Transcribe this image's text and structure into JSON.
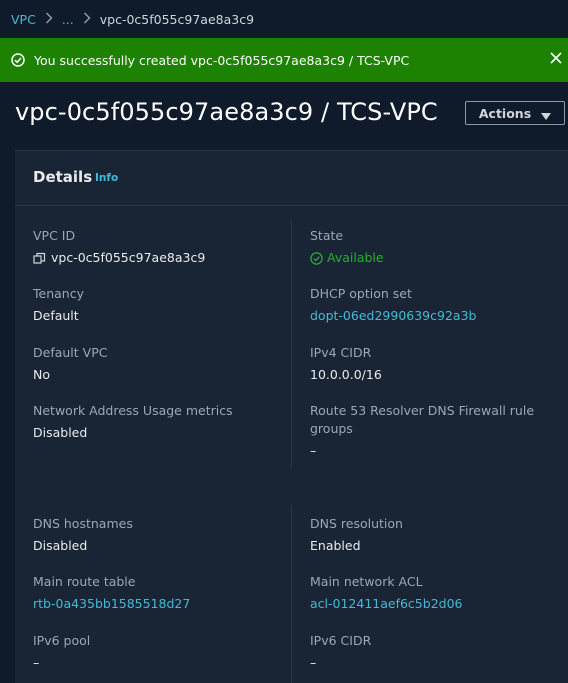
{
  "breadcrumb": {
    "root": "VPC",
    "ellipsis": "...",
    "current": "vpc-0c5f055c97ae8a3c9"
  },
  "flash": {
    "message": "You successfully created vpc-0c5f055c97ae8a3c9 / TCS-VPC",
    "icon": "check-circle-icon",
    "close_icon": "close-icon",
    "color": "#1d8102"
  },
  "page": {
    "title": "vpc-0c5f055c97ae8a3c9 / TCS-VPC",
    "actions_label": "Actions"
  },
  "details": {
    "title": "Details",
    "info_label": "Info",
    "vpc_id": {
      "label": "VPC ID",
      "value": "vpc-0c5f055c97ae8a3c9"
    },
    "state": {
      "label": "State",
      "value": "Available",
      "color": "#29ad32"
    },
    "tenancy": {
      "label": "Tenancy",
      "value": "Default"
    },
    "dhcp": {
      "label": "DHCP option set",
      "value": "dopt-06ed2990639c92a3b"
    },
    "default_vpc": {
      "label": "Default VPC",
      "value": "No"
    },
    "ipv4_cidr": {
      "label": "IPv4 CIDR",
      "value": "10.0.0.0/16"
    },
    "nau_metrics": {
      "label": "Network Address Usage metrics",
      "value": "Disabled"
    },
    "route53": {
      "label_line1": "Route 53 Resolver DNS Firewall rule",
      "label_line2": "groups",
      "value": "–"
    },
    "dns_hostnames": {
      "label": "DNS hostnames",
      "value": "Disabled"
    },
    "dns_resolution": {
      "label": "DNS resolution",
      "value": "Enabled"
    },
    "main_route_table": {
      "label": "Main route table",
      "value": "rtb-0a435bb1585518d27"
    },
    "main_network_acl": {
      "label": "Main network ACL",
      "value": "acl-012411aef6c5b2d06"
    },
    "ipv6_pool": {
      "label": "IPv6 pool",
      "value": "–"
    },
    "ipv6_cidr": {
      "label": "IPv6 CIDR",
      "value": "–"
    }
  },
  "colors": {
    "background": "#0f1b2a",
    "panel": "#192534",
    "link": "#44b9d6"
  }
}
